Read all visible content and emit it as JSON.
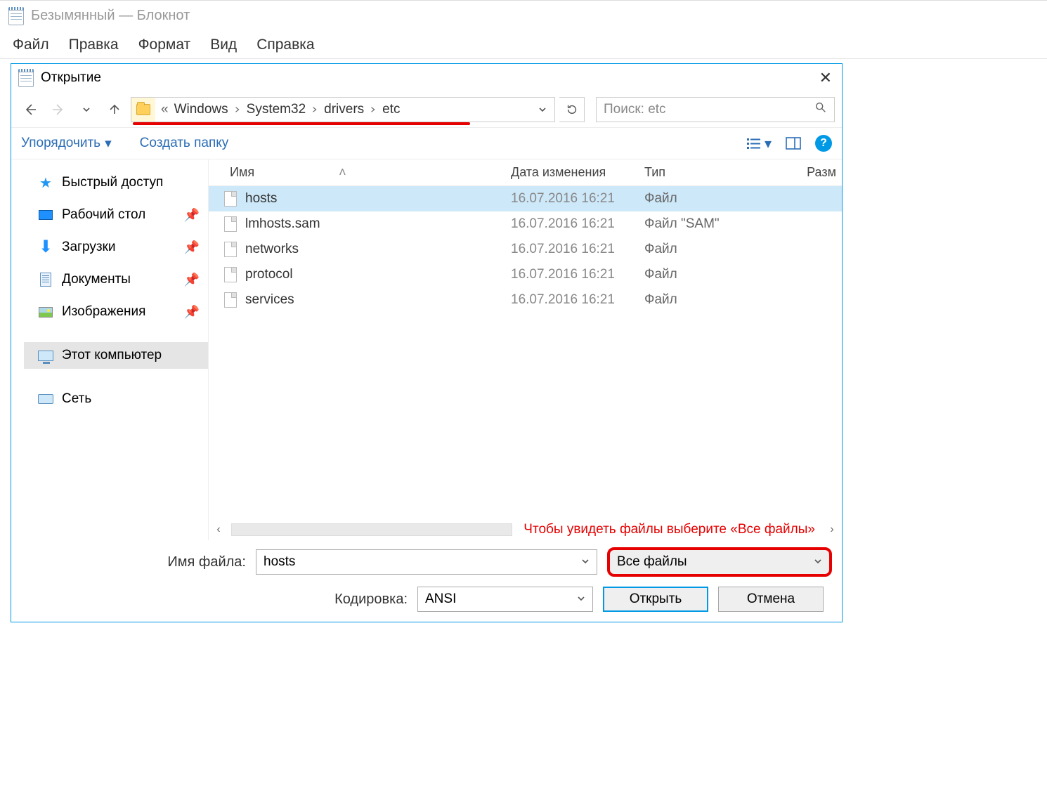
{
  "notepad": {
    "title": "Безымянный — Блокнот",
    "menu": {
      "file": "Файл",
      "edit": "Правка",
      "format": "Формат",
      "view": "Вид",
      "help": "Справка"
    }
  },
  "dialog": {
    "title": "Открытие",
    "breadcrumb": [
      "Windows",
      "System32",
      "drivers",
      "etc"
    ],
    "search_placeholder": "Поиск: etc",
    "toolbar": {
      "organize": "Упорядочить",
      "new_folder": "Создать папку"
    },
    "sidebar": {
      "quick_access": "Быстрый доступ",
      "desktop": "Рабочий стол",
      "downloads": "Загрузки",
      "documents": "Документы",
      "pictures": "Изображения",
      "this_pc": "Этот компьютер",
      "network": "Сеть"
    },
    "columns": {
      "name": "Имя",
      "date": "Дата изменения",
      "type": "Тип",
      "size": "Разм"
    },
    "files": [
      {
        "name": "hosts",
        "date": "16.07.2016 16:21",
        "type": "Файл",
        "selected": true
      },
      {
        "name": "lmhosts.sam",
        "date": "16.07.2016 16:21",
        "type": "Файл \"SAM\"",
        "selected": false
      },
      {
        "name": "networks",
        "date": "16.07.2016 16:21",
        "type": "Файл",
        "selected": false
      },
      {
        "name": "protocol",
        "date": "16.07.2016 16:21",
        "type": "Файл",
        "selected": false
      },
      {
        "name": "services",
        "date": "16.07.2016 16:21",
        "type": "Файл",
        "selected": false
      }
    ],
    "annotation": "Чтобы увидеть файлы выберите «Все файлы»",
    "form": {
      "filename_label": "Имя файла:",
      "filename_value": "hosts",
      "filetype_value": "Все файлы",
      "encoding_label": "Кодировка:",
      "encoding_value": "ANSI",
      "open": "Открыть",
      "cancel": "Отмена"
    }
  }
}
